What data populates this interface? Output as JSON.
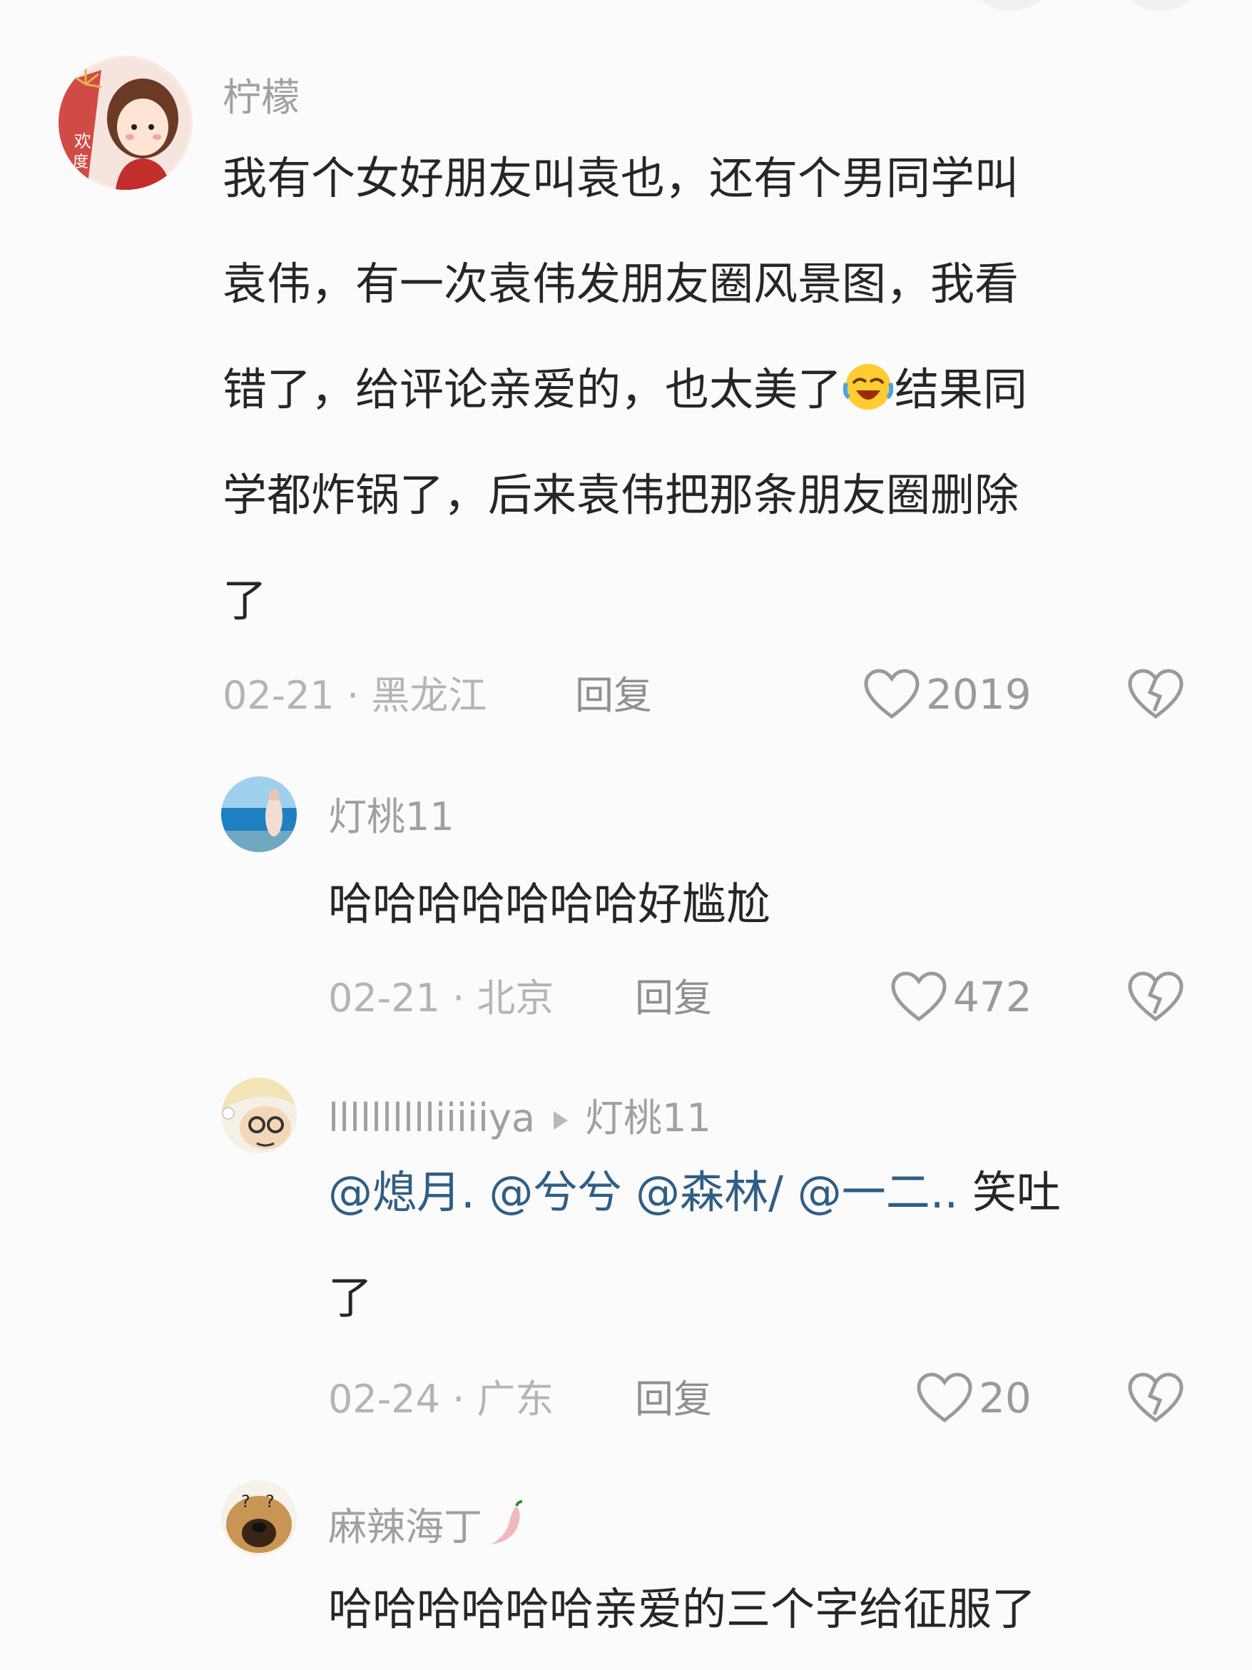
{
  "comments": [
    {
      "username": "柠檬",
      "avatar_icon": "girl-avatar-icon",
      "text_lines": [
        "我有个女好朋友叫袁也，还有个男同学叫",
        "袁伟，有一次袁伟发朋友圈风景图，我看",
        "错了，给评论亲爱的，也太美了",
        "学都炸锅了，后来袁伟把那条朋友圈删除",
        "了"
      ],
      "text_line3_tail": "结果同",
      "emoji": "laughing-crying-emoji",
      "date_location": "02-21 · 黑龙江",
      "reply_label": "回复",
      "likes": "2019"
    },
    {
      "username": "灯桃11",
      "avatar_icon": "sea-photo-avatar-icon",
      "text": "哈哈哈哈哈哈哈好尴尬",
      "date_location": "02-21 · 北京",
      "reply_label": "回复",
      "likes": "472"
    },
    {
      "username": "lllllllllliiiiiya",
      "reply_to": "灯桃11",
      "avatar_icon": "cartoon-avatar-icon",
      "mentions": [
        "@熄月.",
        "@兮兮",
        "@森林/",
        "@一二.."
      ],
      "text_tail": "笑吐",
      "text_line2": "了",
      "date_location": "02-24 · 广东",
      "reply_label": "回复",
      "likes": "20"
    },
    {
      "username": "麻辣海丁",
      "username_emoji": "chili-pepper-icon",
      "avatar_icon": "dog-avatar-icon",
      "text": "哈哈哈哈哈哈亲爱的三个字给征服了"
    }
  ],
  "colors": {
    "background": "#fbfbfb",
    "text": "#262626",
    "meta": "#b4b4b4",
    "mention": "#2f5e86"
  }
}
